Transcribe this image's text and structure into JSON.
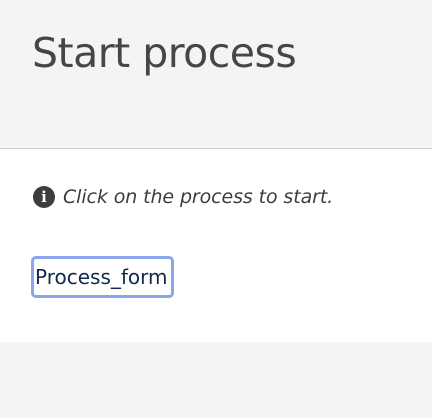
{
  "header": {
    "title": "Start process"
  },
  "panel": {
    "info_icon": "info-circle-icon",
    "info_text": "Click on the process to start.",
    "processes": [
      {
        "label": "Process_form"
      }
    ]
  },
  "colors": {
    "background": "#f4f4f4",
    "panel": "#ffffff",
    "title_text": "#464646",
    "body_text": "#3d3d3d",
    "link_text": "#12294d",
    "focus_outline": "#8aa5ea"
  }
}
